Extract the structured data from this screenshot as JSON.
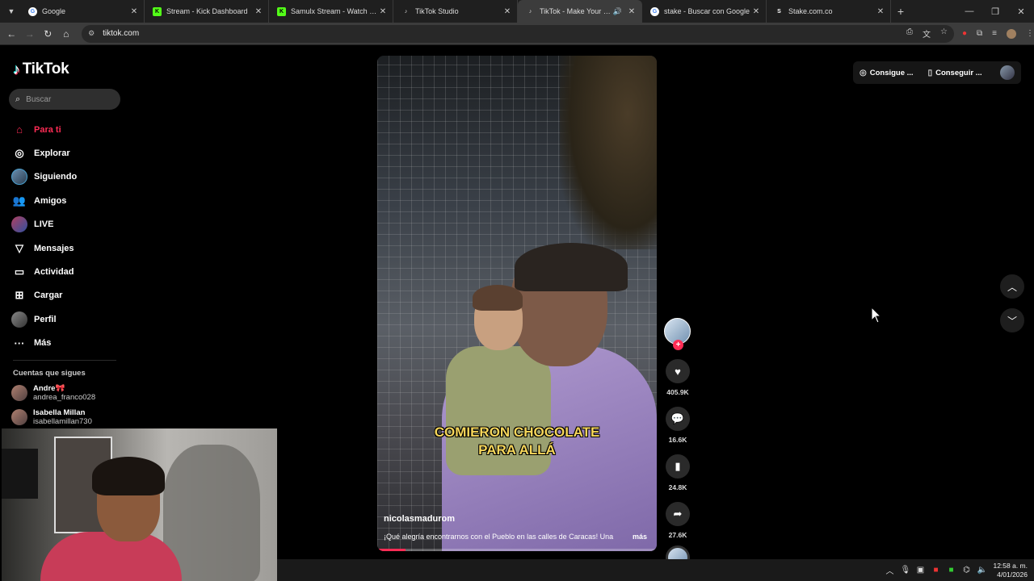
{
  "browser": {
    "tabs": [
      {
        "title": "Google",
        "favicon": "google-icon",
        "color": "#ffffff"
      },
      {
        "title": "Stream - Kick Dashboard",
        "favicon": "kick-icon",
        "color": "#53fc18"
      },
      {
        "title": "Samulx Stream - Watch Live on",
        "favicon": "kick-icon",
        "color": "#53fc18"
      },
      {
        "title": "TikTok Studio",
        "favicon": "tiktok-icon",
        "color": "#ffffff"
      },
      {
        "title": "TikTok - Make Your Day",
        "favicon": "tiktok-icon",
        "color": "#ffffff",
        "active": true,
        "audio": true
      },
      {
        "title": "stake - Buscar con Google",
        "favicon": "google-icon",
        "color": "#ffffff"
      },
      {
        "title": "Stake.com.co",
        "favicon": "stake-icon",
        "color": "#ffffff"
      }
    ],
    "url": "tiktok.com"
  },
  "sidebar": {
    "logo": "TikTok",
    "search_placeholder": "Buscar",
    "items": [
      {
        "label": "Para ti",
        "icon": "home-icon",
        "active": true
      },
      {
        "label": "Explorar",
        "icon": "compass-icon"
      },
      {
        "label": "Siguiendo",
        "icon": "following-avatar-icon"
      },
      {
        "label": "Amigos",
        "icon": "friends-icon"
      },
      {
        "label": "LIVE",
        "icon": "live-icon"
      },
      {
        "label": "Mensajes",
        "icon": "send-icon"
      },
      {
        "label": "Actividad",
        "icon": "activity-icon"
      },
      {
        "label": "Cargar",
        "icon": "upload-icon"
      },
      {
        "label": "Perfil",
        "icon": "profile-avatar-icon"
      },
      {
        "label": "Más",
        "icon": "more-icon"
      }
    ],
    "following_title": "Cuentas que sigues",
    "accounts": [
      {
        "name": "Andre🎀",
        "handle": "andrea_franco028"
      },
      {
        "name": "Isabella Millan",
        "handle": "isabellamillan730"
      }
    ]
  },
  "video": {
    "overlay_line1": "COMIERON CHOCOLATE",
    "overlay_line2": "PARA ALLÁ",
    "author": "nicolasmadurom",
    "description": "¡Qué alegría encontrarnos con el Pueblo en las calles de Caracas! Una",
    "more_label": "más",
    "progress": 0.1
  },
  "actions": {
    "likes": "405.9K",
    "comments": "16.6K",
    "saves": "24.8K",
    "shares": "27.6K"
  },
  "topbar": {
    "coins_label": "Consigue ...",
    "app_label": "Conseguir ..."
  },
  "taskbar": {
    "time": "12:58 a. m.",
    "date": "4/01/2026"
  },
  "colors": {
    "accent": "#fe2c55",
    "caption": "#f6d65a"
  }
}
